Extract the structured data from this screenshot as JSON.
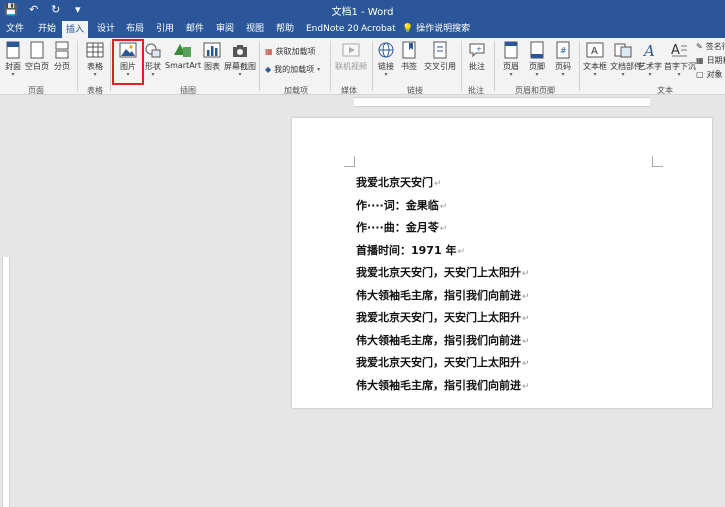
{
  "app": {
    "title": "文档1 - Word"
  },
  "quick_access": {
    "save_icon": "💾",
    "undo_icon": "↶",
    "redo_icon": "↻",
    "customize_icon": "▾"
  },
  "tabs": [
    "文件",
    "开始",
    "插入",
    "设计",
    "布局",
    "引用",
    "邮件",
    "审阅",
    "视图",
    "帮助",
    "EndNote 20",
    "Acrobat"
  ],
  "active_tab": "插入",
  "tell_me": "操作说明搜索",
  "ribbon": {
    "pages_group": {
      "label": "页面",
      "cover": "封面",
      "blank": "空白页",
      "break": "分页"
    },
    "tables_group": {
      "label": "表格",
      "table": "表格"
    },
    "illustrations_group": {
      "label": "插图",
      "pictures": "图片",
      "shapes": "形状",
      "smartart": "SmartArt",
      "chart": "图表",
      "screenshot": "屏幕截图"
    },
    "addins_group": {
      "label": "加载项",
      "get_addins": "获取加载项",
      "my_addins": "我的加载项"
    },
    "media_group": {
      "label": "媒体",
      "online_video": "联机视频"
    },
    "links_group": {
      "label": "链接",
      "link": "链接",
      "bookmark": "书签",
      "cross_ref": "交叉引用"
    },
    "comments_group": {
      "label": "批注",
      "comment": "批注"
    },
    "header_footer_group": {
      "label": "页眉和页脚",
      "header": "页眉",
      "footer": "页脚",
      "page_number": "页码"
    },
    "text_group": {
      "label": "文本",
      "textbox": "文本框",
      "quickparts": "文档部件",
      "wordart": "艺术字",
      "dropcap": "首字下沉",
      "signature": "签名行",
      "datetime": "日期和时间",
      "object": "对象"
    }
  },
  "document": {
    "paragraph_mark": "↵",
    "lines": [
      "我爱北京天安门",
      "作····词：金果临",
      "作····曲：金月苓",
      "首播时间：1971 年",
      "我爱北京天安门，天安门上太阳升",
      "伟大领袖毛主席，指引我们向前进",
      "我爱北京天安门，天安门上太阳升",
      "伟大领袖毛主席，指引我们向前进",
      "我爱北京天安门，天安门上太阳升",
      "伟大领袖毛主席，指引我们向前进"
    ]
  }
}
